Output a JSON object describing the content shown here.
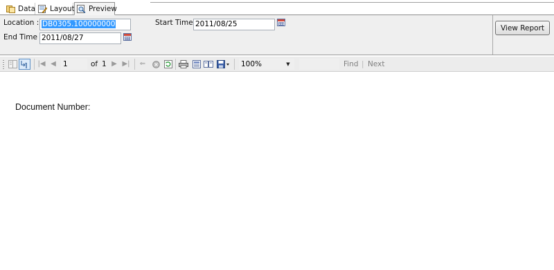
{
  "tabs": [
    {
      "label": "Data",
      "active": false,
      "icon": "data-icon"
    },
    {
      "label": "Layout",
      "active": false,
      "icon": "layout-icon"
    },
    {
      "label": "Preview",
      "active": true,
      "icon": "preview-icon"
    }
  ],
  "params": {
    "location_label": "Location :",
    "location_value": "DB0305.100000000",
    "start_time_label": "Start Time :",
    "start_time_value": "2011/08/25",
    "end_time_label": "End Time :",
    "end_time_value": "2011/08/27",
    "view_report_label": "View Report"
  },
  "toolbar": {
    "page_current": "1",
    "of_label": "of",
    "page_total": "1",
    "zoom": "100%",
    "find_value": "",
    "find_label": "Find",
    "next_label": "Next"
  },
  "report": {
    "document_number_label": "Document Number:"
  },
  "colors": {
    "selection": "#3399ff",
    "param_bg": "#efefef",
    "toolbar_bg": "#ececec"
  }
}
